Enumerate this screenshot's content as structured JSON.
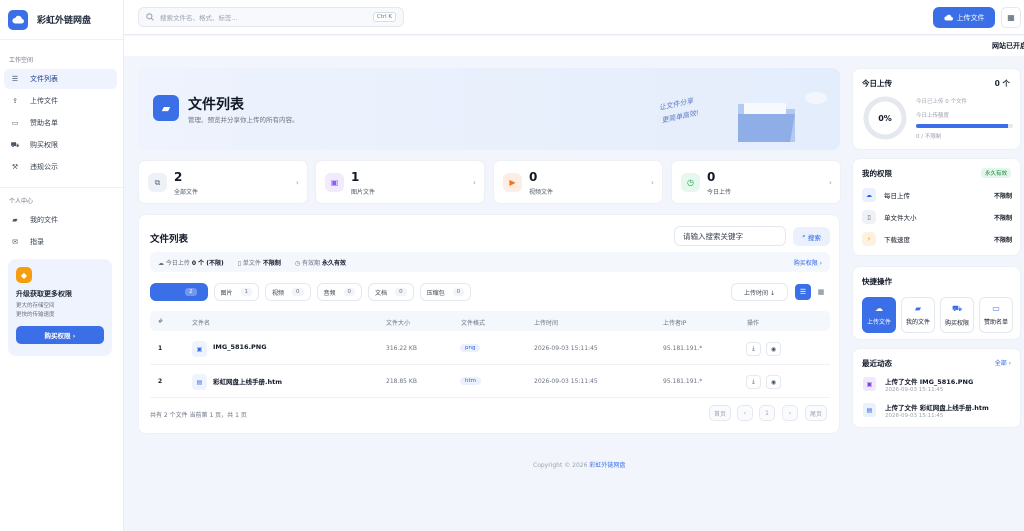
{
  "brand": {
    "name": "彩虹外链网盘"
  },
  "sidebar": {
    "section_work": "工作空间",
    "work_items": [
      {
        "label": "文件列表",
        "icon": "list-icon"
      },
      {
        "label": "上传文件",
        "icon": "upload-icon"
      },
      {
        "label": "赞助名单",
        "icon": "sponsor-icon"
      },
      {
        "label": "购买权限",
        "icon": "cart-icon"
      },
      {
        "label": "违规公示",
        "icon": "hammer-icon"
      }
    ],
    "section_personal": "个人中心",
    "personal_items": [
      {
        "label": "我的文件",
        "icon": "folder-icon"
      },
      {
        "label": "指录",
        "icon": "mail-icon"
      }
    ],
    "promo": {
      "title": "升级获取更多权限",
      "line1": "更大的存储空间",
      "line2": "更快的传输速度",
      "button": "购买权限 ›"
    }
  },
  "topbar": {
    "search_placeholder": "搜索文件名、格式、标签...",
    "shortcut": "Ctrl K",
    "upload_label": "上传文件"
  },
  "marquee": {
    "text": "网站已开启"
  },
  "hero": {
    "title": "文件列表",
    "subtitle": "管理、预览并分享你上传的所有内容。",
    "note_line1": "让文件分享",
    "note_line2": "更简单高效!"
  },
  "stats": [
    {
      "value": "2",
      "label": "全部文件"
    },
    {
      "value": "1",
      "label": "图片文件"
    },
    {
      "value": "0",
      "label": "视频文件"
    },
    {
      "value": "0",
      "label": "今日上传"
    }
  ],
  "panel": {
    "title": "文件列表",
    "search_value": "请输入搜索关键字",
    "search_button": "搜索",
    "info": {
      "today_label": "今日上传",
      "today_value": "0 个 (不限)",
      "single_label": "单文件",
      "single_value": "不限制",
      "valid_label": "有效期",
      "valid_value": "永久有效",
      "buy_link": "购买权限 ›"
    },
    "tabs": [
      {
        "label": "",
        "count": "2"
      },
      {
        "label": "图片",
        "count": "1"
      },
      {
        "label": "视频",
        "count": "0"
      },
      {
        "label": "音频",
        "count": "0"
      },
      {
        "label": "文档",
        "count": "0"
      },
      {
        "label": "压缩包",
        "count": "0"
      }
    ],
    "sort_label": "上传时间 ↓",
    "columns": [
      "#",
      "文件名",
      "文件大小",
      "文件格式",
      "上传时间",
      "上传者IP",
      "操作"
    ],
    "rows": [
      {
        "idx": "1",
        "name": "IMG_5816.PNG",
        "size": "316.22 KB",
        "format": "png",
        "time": "2026-09-03 15:11:45",
        "ip": "95.181.191.*"
      },
      {
        "idx": "2",
        "name": "彩虹网盘上线手册.htm",
        "size": "218.85 KB",
        "format": "htm",
        "time": "2026-09-03 15:11:45",
        "ip": "95.181.191.*"
      }
    ],
    "footer": "共有 2 个文件  当前第 1 页，共 1 页",
    "pager": {
      "first": "首页",
      "prev": "‹",
      "current": "1",
      "next": "›",
      "last": "尾页"
    }
  },
  "copyright": {
    "prefix": "Copyright © 2026 ",
    "link": "彩虹外链网盘"
  },
  "today": {
    "title": "今日上传",
    "count": "0 个",
    "percent": "0%",
    "line1": "今日已上传 0 个文件",
    "line2": "今日上传额度",
    "quota": "0 / 不限制",
    "progress": 0.95
  },
  "rights": {
    "title": "我的权限",
    "badge": "永久有效",
    "items": [
      {
        "label": "每日上传",
        "value": "不限制"
      },
      {
        "label": "单文件大小",
        "value": "不限制"
      },
      {
        "label": "下载速度",
        "value": "不限制"
      }
    ]
  },
  "quick": {
    "title": "快捷操作",
    "items": [
      {
        "label": "上传文件",
        "icon": "cloud-upload-icon"
      },
      {
        "label": "我的文件",
        "icon": "folder-icon"
      },
      {
        "label": "购买权限",
        "icon": "cart-icon"
      },
      {
        "label": "赞助名单",
        "icon": "sponsor-icon"
      }
    ]
  },
  "recent": {
    "title": "最近动态",
    "all": "全部 ›",
    "items": [
      {
        "title": "上传了文件 IMG_5816.PNG",
        "time": "2026-09-03 15:11:45"
      },
      {
        "title": "上传了文件 彩虹网盘上线手册.htm",
        "time": "2026-09-03 15:11:45"
      }
    ]
  },
  "colors": {
    "accent": "#3b6fe8",
    "background": "#f2f5fb"
  }
}
